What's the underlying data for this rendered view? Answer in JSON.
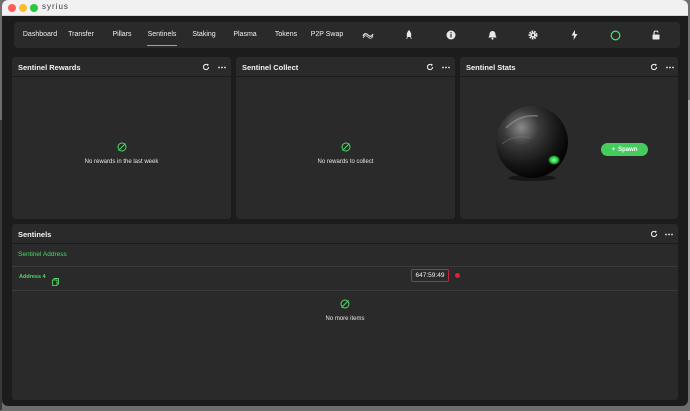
{
  "window": {
    "title": "syrius"
  },
  "nav": {
    "tabs": [
      {
        "label": "Dashboard"
      },
      {
        "label": "Transfer"
      },
      {
        "label": "Pillars"
      },
      {
        "label": "Sentinels"
      },
      {
        "label": "Staking"
      },
      {
        "label": "Plasma"
      },
      {
        "label": "Tokens"
      },
      {
        "label": "P2P Swap"
      }
    ],
    "active_tab": "Sentinels",
    "icons": [
      "bridge-icon",
      "rocket-icon",
      "info-icon",
      "notification-bell-icon",
      "settings-gear-icon",
      "lightning-icon",
      "sync-status-icon",
      "lock-icon"
    ],
    "accent_color": "#4fd86a"
  },
  "sentinel_rewards": {
    "title": "Sentinel Rewards",
    "empty_text": "No rewards in the last week"
  },
  "sentinel_collect": {
    "title": "Sentinel Collect",
    "empty_text": "No rewards to collect"
  },
  "sentinel_stats": {
    "title": "Sentinel Stats",
    "spawn_label": "Spawn"
  },
  "sentinels": {
    "title": "Sentinels",
    "column_header": "Sentinel Address",
    "rows": [
      {
        "address": "Address 4",
        "timer": "647:59:49",
        "status_color": "#e0203c"
      }
    ],
    "empty_text": "No more items"
  }
}
